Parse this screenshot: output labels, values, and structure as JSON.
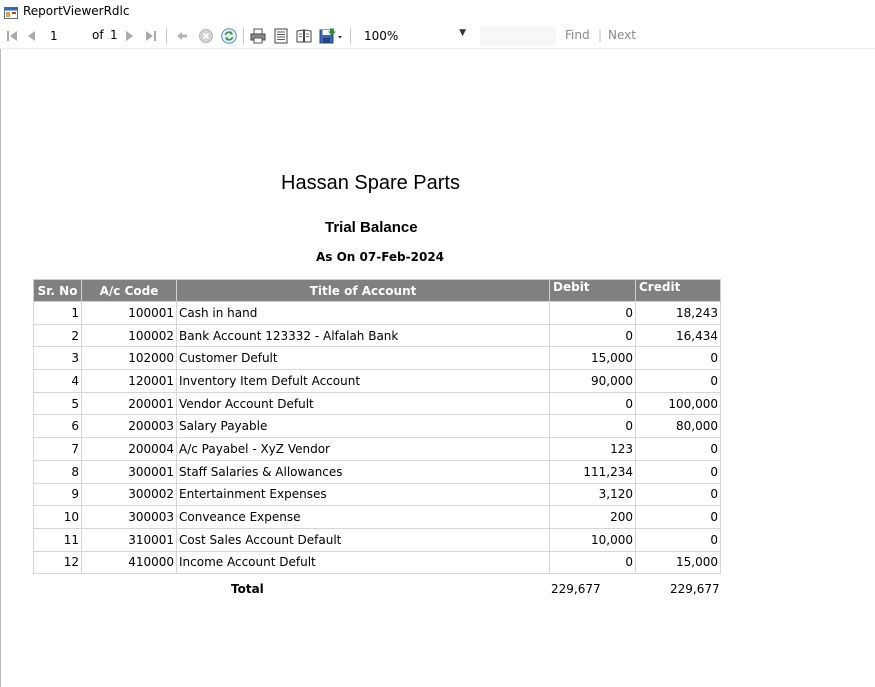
{
  "window": {
    "title": "ReportViewerRdlc"
  },
  "toolbar": {
    "page_current": "1",
    "of_label": "of",
    "page_total": "1",
    "zoom": "100%",
    "find_label": "Find",
    "find_separator": "|",
    "next_label": "Next",
    "icons": [
      "first-page-icon",
      "prev-page-icon",
      "next-page-icon",
      "last-page-icon",
      "back-icon",
      "stop-icon",
      "refresh-icon",
      "print-icon",
      "print-layout-icon",
      "page-setup-icon",
      "export-icon"
    ]
  },
  "report": {
    "company": "Hassan Spare Parts",
    "title": "Trial Balance",
    "date_line": "As On 07-Feb-2024",
    "columns": [
      "Sr. No",
      "A/c Code",
      "Title of Account",
      "Debit",
      "Credit"
    ],
    "rows": [
      {
        "sr": "1",
        "code": "100001",
        "title": "Cash in hand",
        "debit": "0",
        "credit": "18,243"
      },
      {
        "sr": "2",
        "code": "100002",
        "title": "Bank Account 123332 - Alfalah Bank",
        "debit": "0",
        "credit": "16,434"
      },
      {
        "sr": "3",
        "code": "102000",
        "title": "Customer Defult",
        "debit": "15,000",
        "credit": "0"
      },
      {
        "sr": "4",
        "code": "120001",
        "title": "Inventory Item Defult Account",
        "debit": "90,000",
        "credit": "0"
      },
      {
        "sr": "5",
        "code": "200001",
        "title": "Vendor Account Defult",
        "debit": "0",
        "credit": "100,000"
      },
      {
        "sr": "6",
        "code": "200003",
        "title": "Salary Payable",
        "debit": "0",
        "credit": "80,000"
      },
      {
        "sr": "7",
        "code": "200004",
        "title": "A/c Payabel - XyZ Vendor",
        "debit": "123",
        "credit": "0"
      },
      {
        "sr": "8",
        "code": "300001",
        "title": "Staff Salaries & Allowances",
        "debit": "111,234",
        "credit": "0"
      },
      {
        "sr": "9",
        "code": "300002",
        "title": "Entertainment Expenses",
        "debit": "3,120",
        "credit": "0"
      },
      {
        "sr": "10",
        "code": "300003",
        "title": "Conveance Expense",
        "debit": "200",
        "credit": "0"
      },
      {
        "sr": "11",
        "code": "310001",
        "title": "Cost Sales Account Default",
        "debit": "10,000",
        "credit": "0"
      },
      {
        "sr": "12",
        "code": "410000",
        "title": "Income Account Defult",
        "debit": "0",
        "credit": "15,000"
      }
    ],
    "total_label": "Total",
    "total_debit": "229,677",
    "total_credit": "229,677"
  }
}
